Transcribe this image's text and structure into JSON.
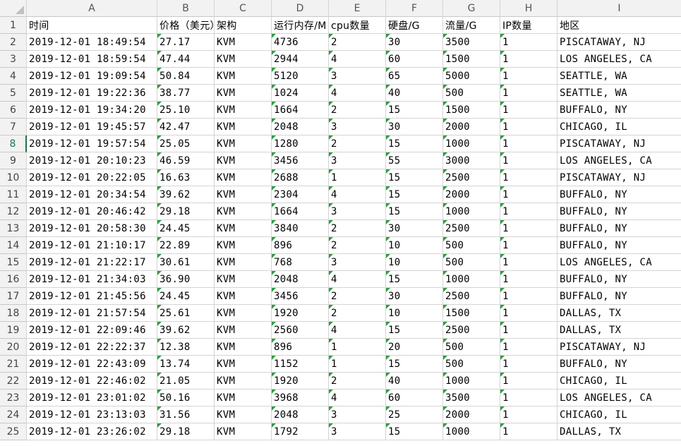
{
  "columns": [
    "A",
    "B",
    "C",
    "D",
    "E",
    "F",
    "G",
    "H",
    "I"
  ],
  "header_row": {
    "row_number": "1",
    "cells": [
      "时间",
      "价格（美元）",
      "架构",
      "运行内存/M",
      "cpu数量",
      "硬盘/G",
      "流量/G",
      "IP数量",
      "地区"
    ]
  },
  "active_row": 8,
  "rows": [
    {
      "n": "2",
      "cells": [
        "2019-12-01 18:49:54",
        "27.17",
        "KVM",
        "4736",
        "2",
        "30",
        "3500",
        "1",
        "PISCATAWAY, NJ"
      ]
    },
    {
      "n": "3",
      "cells": [
        "2019-12-01 18:59:54",
        "47.44",
        "KVM",
        "2944",
        "4",
        "60",
        "1500",
        "1",
        "LOS ANGELES, CA"
      ]
    },
    {
      "n": "4",
      "cells": [
        "2019-12-01 19:09:54",
        "50.84",
        "KVM",
        "5120",
        "3",
        "65",
        "5000",
        "1",
        "SEATTLE, WA"
      ]
    },
    {
      "n": "5",
      "cells": [
        "2019-12-01 19:22:36",
        "38.77",
        "KVM",
        "1024",
        "4",
        "40",
        "500",
        "1",
        "SEATTLE, WA"
      ]
    },
    {
      "n": "6",
      "cells": [
        "2019-12-01 19:34:20",
        "25.10",
        "KVM",
        "1664",
        "2",
        "15",
        "1500",
        "1",
        "BUFFALO, NY"
      ]
    },
    {
      "n": "7",
      "cells": [
        "2019-12-01 19:45:57",
        "42.47",
        "KVM",
        "2048",
        "3",
        "30",
        "2000",
        "1",
        "CHICAGO, IL"
      ]
    },
    {
      "n": "8",
      "cells": [
        "2019-12-01 19:57:54",
        "25.05",
        "KVM",
        "1280",
        "2",
        "15",
        "1000",
        "1",
        "PISCATAWAY, NJ"
      ]
    },
    {
      "n": "9",
      "cells": [
        "2019-12-01 20:10:23",
        "46.59",
        "KVM",
        "3456",
        "3",
        "55",
        "3000",
        "1",
        "LOS ANGELES, CA"
      ]
    },
    {
      "n": "10",
      "cells": [
        "2019-12-01 20:22:05",
        "16.63",
        "KVM",
        "2688",
        "1",
        "15",
        "2500",
        "1",
        "PISCATAWAY, NJ"
      ]
    },
    {
      "n": "11",
      "cells": [
        "2019-12-01 20:34:54",
        "39.62",
        "KVM",
        "2304",
        "4",
        "15",
        "2000",
        "1",
        "BUFFALO, NY"
      ]
    },
    {
      "n": "12",
      "cells": [
        "2019-12-01 20:46:42",
        "29.18",
        "KVM",
        "1664",
        "3",
        "15",
        "1000",
        "1",
        "BUFFALO, NY"
      ]
    },
    {
      "n": "13",
      "cells": [
        "2019-12-01 20:58:30",
        "24.45",
        "KVM",
        "3840",
        "2",
        "30",
        "2500",
        "1",
        "BUFFALO, NY"
      ]
    },
    {
      "n": "14",
      "cells": [
        "2019-12-01 21:10:17",
        "22.89",
        "KVM",
        "896",
        "2",
        "10",
        "500",
        "1",
        "BUFFALO, NY"
      ]
    },
    {
      "n": "15",
      "cells": [
        "2019-12-01 21:22:17",
        "30.61",
        "KVM",
        "768",
        "3",
        "10",
        "500",
        "1",
        "LOS ANGELES, CA"
      ]
    },
    {
      "n": "16",
      "cells": [
        "2019-12-01 21:34:03",
        "36.90",
        "KVM",
        "2048",
        "4",
        "15",
        "1000",
        "1",
        "BUFFALO, NY"
      ]
    },
    {
      "n": "17",
      "cells": [
        "2019-12-01 21:45:56",
        "24.45",
        "KVM",
        "3456",
        "2",
        "30",
        "2500",
        "1",
        "BUFFALO, NY"
      ]
    },
    {
      "n": "18",
      "cells": [
        "2019-12-01 21:57:54",
        "25.61",
        "KVM",
        "1920",
        "2",
        "10",
        "1500",
        "1",
        "DALLAS, TX"
      ]
    },
    {
      "n": "19",
      "cells": [
        "2019-12-01 22:09:46",
        "39.62",
        "KVM",
        "2560",
        "4",
        "15",
        "2500",
        "1",
        "DALLAS, TX"
      ]
    },
    {
      "n": "20",
      "cells": [
        "2019-12-01 22:22:37",
        "12.38",
        "KVM",
        "896",
        "1",
        "20",
        "500",
        "1",
        "PISCATAWAY, NJ"
      ]
    },
    {
      "n": "21",
      "cells": [
        "2019-12-01 22:43:09",
        "13.74",
        "KVM",
        "1152",
        "1",
        "15",
        "500",
        "1",
        "BUFFALO, NY"
      ]
    },
    {
      "n": "22",
      "cells": [
        "2019-12-01 22:46:02",
        "21.05",
        "KVM",
        "1920",
        "2",
        "40",
        "1000",
        "1",
        "CHICAGO, IL"
      ]
    },
    {
      "n": "23",
      "cells": [
        "2019-12-01 23:01:02",
        "50.16",
        "KVM",
        "3968",
        "4",
        "60",
        "3500",
        "1",
        "LOS ANGELES, CA"
      ]
    },
    {
      "n": "24",
      "cells": [
        "2019-12-01 23:13:03",
        "31.56",
        "KVM",
        "2048",
        "3",
        "25",
        "2000",
        "1",
        "CHICAGO, IL"
      ]
    },
    {
      "n": "25",
      "cells": [
        "2019-12-01 23:26:02",
        "29.18",
        "KVM",
        "1792",
        "3",
        "15",
        "1000",
        "1",
        "DALLAS, TX"
      ]
    }
  ],
  "colors": {
    "active_accent": "#217346",
    "error_marker": "#2e9e3e"
  }
}
